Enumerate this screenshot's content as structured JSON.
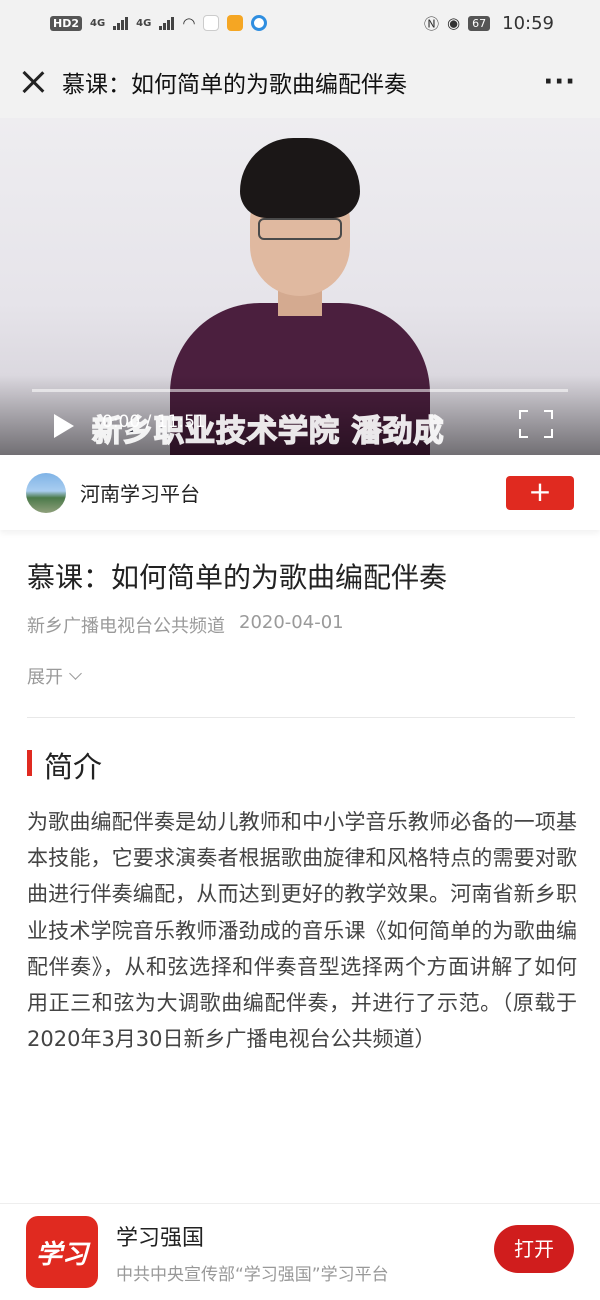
{
  "status_bar": {
    "network_badge": "HD2",
    "signal1": "4G",
    "signal2": "4G",
    "battery": "67",
    "time": "10:59"
  },
  "title_bar": {
    "title": "慕课：如何简单的为歌曲编配伴奏",
    "more": "···"
  },
  "video": {
    "time": "0:00 / 11:51",
    "caption": "新乡职业技术学院  潘劲成"
  },
  "channel": {
    "name": "河南学习平台",
    "follow": "+"
  },
  "article": {
    "title": "慕课：如何简单的为歌曲编配伴奏",
    "source": "新乡广播电视台公共频道",
    "date": "2020-04-01",
    "expand": "展开",
    "section_title": "简介",
    "intro": "为歌曲编配伴奏是幼儿教师和中小学音乐教师必备的一项基本技能，它要求演奏者根据歌曲旋律和风格特点的需要对歌曲进行伴奏编配，从而达到更好的教学效果。河南省新乡职业技术学院音乐教师潘劲成的音乐课《如何简单的为歌曲编配伴奏》，从和弦选择和伴奏音型选择两个方面讲解了如何用正三和弦为大调歌曲编配伴奏，并进行了示范。（原载于2020年3月30日新乡广播电视台公共频道）"
  },
  "app_bar": {
    "logo": "学习",
    "name": "学习强国",
    "subtitle": "中共中央宣传部“学习强国”学习平台",
    "open": "打开"
  },
  "colors": {
    "accent": "#e02a20",
    "meta": "#9a9a9a"
  }
}
